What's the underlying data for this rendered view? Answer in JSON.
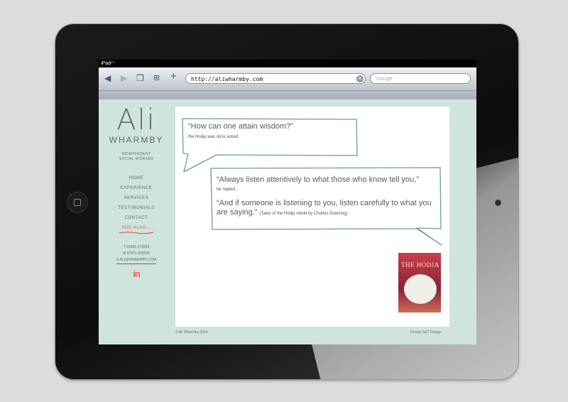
{
  "device": {
    "status_label": "iPad"
  },
  "browser": {
    "url": "http://aliwharmby.com",
    "search_placeholder": "Google",
    "clear_glyph": "⊗"
  },
  "site": {
    "logo_first": "Ali",
    "logo_last": "WHARMBY",
    "tagline_line1": "INDEPENDENT",
    "tagline_line2": "SOCIAL WORKER",
    "nav": [
      {
        "label": "HOME",
        "active": false
      },
      {
        "label": "EXPERIENCE",
        "active": false
      },
      {
        "label": "SERVICES",
        "active": false
      },
      {
        "label": "TESTIMONIALS",
        "active": false
      },
      {
        "label": "CONTACT",
        "active": false
      },
      {
        "label": "AND ALSO...",
        "active": true
      }
    ],
    "contact": {
      "phone": "T 01665 373559",
      "mobile": "M 07971 022549",
      "email": "E ALI@WHARMBY.COM"
    },
    "linkedin": "in",
    "accent_color": "#e06060",
    "background_color": "#cfe4dc"
  },
  "content": {
    "quote1": "“How can one attain wisdom?”",
    "quote1_attr": "the Hodja was once asked.",
    "quote2": "“Always listen attentively to what those who know tell you,”",
    "quote2_attr": "he replied.",
    "quote3": "“And if someone is listening to you, listen carefully to what you are saying.”",
    "quote3_attr": "(Tales of the Hodja retold by Charles Downing)",
    "book_title": "THE HODJA"
  },
  "footer": {
    "copyright": "© Ali Wharmby 2014",
    "credit": "Design S&T Design"
  }
}
